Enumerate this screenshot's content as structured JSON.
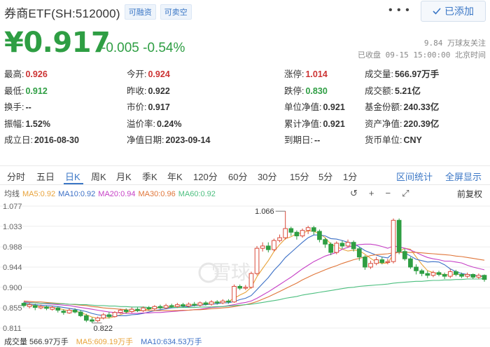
{
  "header": {
    "stock_name": "券商ETF(SH:512000)",
    "tags": [
      "可融资",
      "可卖空"
    ],
    "more": "• • •",
    "add_button": "已添加",
    "check_icon": "check-icon"
  },
  "quote": {
    "price": "¥0.917",
    "change": "-0.005 -0.54%",
    "followers": "9.84 万球友关注",
    "status": "已收盘 09-15 15:00:00 北京时间"
  },
  "stats": [
    {
      "label": "最高:",
      "value": "0.926",
      "tone": "red"
    },
    {
      "label": "今开:",
      "value": "0.924",
      "tone": "red"
    },
    {
      "label": "涨停:",
      "value": "1.014",
      "tone": "red"
    },
    {
      "label": "成交量:",
      "value": "566.97万手",
      "tone": ""
    },
    {
      "label": "最低:",
      "value": "0.912",
      "tone": "green"
    },
    {
      "label": "昨收:",
      "value": "0.922",
      "tone": ""
    },
    {
      "label": "跌停:",
      "value": "0.830",
      "tone": "green"
    },
    {
      "label": "成交额:",
      "value": "5.21亿",
      "tone": ""
    },
    {
      "label": "换手:",
      "value": "--",
      "tone": ""
    },
    {
      "label": "市价:",
      "value": "0.917",
      "tone": ""
    },
    {
      "label": "单位净值:",
      "value": "0.921",
      "tone": ""
    },
    {
      "label": "基金份额:",
      "value": "240.33亿",
      "tone": ""
    },
    {
      "label": "振幅:",
      "value": "1.52%",
      "tone": ""
    },
    {
      "label": "溢价率:",
      "value": "0.24%",
      "tone": ""
    },
    {
      "label": "累计净值:",
      "value": "0.921",
      "tone": ""
    },
    {
      "label": "资产净值:",
      "value": "220.39亿",
      "tone": ""
    },
    {
      "label": "成立日:",
      "value": "2016-08-30",
      "tone": ""
    },
    {
      "label": "净值日期:",
      "value": "2023-09-14",
      "tone": ""
    },
    {
      "label": "到期日:",
      "value": "--",
      "tone": ""
    },
    {
      "label": "货币单位:",
      "value": "CNY",
      "tone": ""
    }
  ],
  "tabs": [
    "分时",
    "五日",
    "日K",
    "周K",
    "月K",
    "季K",
    "年K",
    "120分",
    "60分",
    "30分",
    "15分",
    "5分",
    "1分"
  ],
  "active_tab": "日K",
  "tab_actions": [
    "区间统计",
    "全屏显示"
  ],
  "ma_legend": [
    {
      "label": "均线",
      "color": "#555555"
    },
    {
      "label": "MA5:0.92",
      "color": "#e8a33a"
    },
    {
      "label": "MA10:0.92",
      "color": "#3b6fc6"
    },
    {
      "label": "MA20:0.94",
      "color": "#c640c6"
    },
    {
      "label": "MA30:0.96",
      "color": "#e0763a"
    },
    {
      "label": "MA60:0.92",
      "color": "#4cbf7f"
    }
  ],
  "chart_tools": [
    "↺",
    "+",
    "−",
    "⤢"
  ],
  "fuquan": "前复权",
  "watermark": "雪球",
  "chart_data": {
    "type": "candlestick",
    "y_ticks": [
      "1.077",
      "1.033",
      "0.988",
      "0.944",
      "0.900",
      "0.855",
      "0.811"
    ],
    "ylim": [
      0.811,
      1.077
    ],
    "high_label": "1.066",
    "low_label": "0.822",
    "candles": [
      [
        0.865,
        0.86,
        0.868,
        0.856
      ],
      [
        0.858,
        0.862,
        0.866,
        0.854
      ],
      [
        0.86,
        0.856,
        0.864,
        0.85
      ],
      [
        0.855,
        0.858,
        0.862,
        0.852
      ],
      [
        0.857,
        0.854,
        0.86,
        0.85
      ],
      [
        0.852,
        0.856,
        0.86,
        0.849
      ],
      [
        0.855,
        0.85,
        0.858,
        0.845
      ],
      [
        0.848,
        0.845,
        0.852,
        0.84
      ],
      [
        0.844,
        0.85,
        0.854,
        0.842
      ],
      [
        0.85,
        0.846,
        0.854,
        0.843
      ],
      [
        0.846,
        0.838,
        0.85,
        0.835
      ],
      [
        0.838,
        0.828,
        0.842,
        0.824
      ],
      [
        0.829,
        0.826,
        0.834,
        0.822
      ],
      [
        0.827,
        0.833,
        0.836,
        0.824
      ],
      [
        0.833,
        0.84,
        0.844,
        0.83
      ],
      [
        0.84,
        0.836,
        0.846,
        0.832
      ],
      [
        0.836,
        0.845,
        0.848,
        0.834
      ],
      [
        0.845,
        0.85,
        0.853,
        0.842
      ],
      [
        0.85,
        0.847,
        0.854,
        0.843
      ],
      [
        0.847,
        0.852,
        0.856,
        0.844
      ],
      [
        0.852,
        0.849,
        0.856,
        0.846
      ],
      [
        0.849,
        0.855,
        0.858,
        0.846
      ],
      [
        0.855,
        0.853,
        0.859,
        0.85
      ],
      [
        0.853,
        0.858,
        0.861,
        0.85
      ],
      [
        0.858,
        0.855,
        0.862,
        0.852
      ],
      [
        0.855,
        0.86,
        0.864,
        0.852
      ],
      [
        0.86,
        0.858,
        0.864,
        0.855
      ],
      [
        0.858,
        0.862,
        0.866,
        0.855
      ],
      [
        0.862,
        0.859,
        0.866,
        0.856
      ],
      [
        0.859,
        0.863,
        0.867,
        0.856
      ],
      [
        0.863,
        0.861,
        0.868,
        0.858
      ],
      [
        0.861,
        0.866,
        0.869,
        0.858
      ],
      [
        0.866,
        0.863,
        0.87,
        0.86
      ],
      [
        0.863,
        0.868,
        0.872,
        0.86
      ],
      [
        0.868,
        0.866,
        0.872,
        0.862
      ],
      [
        0.866,
        0.87,
        0.874,
        0.863
      ],
      [
        0.87,
        0.868,
        0.874,
        0.864
      ],
      [
        0.868,
        0.902,
        0.906,
        0.866
      ],
      [
        0.902,
        0.898,
        0.906,
        0.894
      ],
      [
        0.898,
        0.9,
        0.905,
        0.894
      ],
      [
        0.9,
        0.93,
        0.934,
        0.897
      ],
      [
        0.93,
        0.985,
        0.99,
        0.926
      ],
      [
        0.985,
        0.99,
        0.998,
        0.978
      ],
      [
        0.99,
        0.982,
        0.998,
        0.976
      ],
      [
        0.982,
        1.002,
        1.006,
        0.978
      ],
      [
        1.002,
        1.008,
        1.015,
        0.998
      ],
      [
        1.008,
        1.028,
        1.066,
        1.004
      ],
      [
        1.028,
        1.02,
        1.032,
        1.012
      ],
      [
        1.02,
        1.012,
        1.024,
        1.004
      ],
      [
        1.012,
        1.024,
        1.028,
        1.008
      ],
      [
        1.024,
        1.03,
        1.034,
        1.016
      ],
      [
        1.03,
        1.022,
        1.034,
        1.014
      ],
      [
        1.022,
        1.004,
        1.026,
        0.998
      ],
      [
        1.004,
        0.994,
        1.008,
        0.986
      ],
      [
        0.994,
        0.976,
        0.998,
        0.97
      ],
      [
        0.976,
        0.996,
        1.0,
        0.972
      ],
      [
        0.996,
        0.99,
        1.002,
        0.984
      ],
      [
        0.99,
        0.998,
        1.004,
        0.986
      ],
      [
        0.998,
        0.984,
        1.002,
        0.978
      ],
      [
        0.984,
        0.966,
        0.988,
        0.958
      ],
      [
        0.966,
        0.944,
        0.97,
        0.938
      ],
      [
        0.944,
        0.952,
        0.958,
        0.94
      ],
      [
        0.952,
        0.96,
        0.966,
        0.948
      ],
      [
        0.96,
        0.954,
        0.966,
        0.95
      ],
      [
        0.954,
        0.956,
        0.962,
        0.95
      ],
      [
        0.956,
        1.046,
        1.05,
        0.952
      ],
      [
        1.046,
        0.978,
        1.05,
        0.972
      ],
      [
        0.978,
        0.962,
        0.984,
        0.958
      ],
      [
        0.962,
        0.944,
        0.966,
        0.94
      ],
      [
        0.944,
        0.936,
        0.95,
        0.928
      ],
      [
        0.936,
        0.93,
        0.94,
        0.924
      ],
      [
        0.93,
        0.926,
        0.936,
        0.92
      ],
      [
        0.926,
        0.932,
        0.936,
        0.922
      ],
      [
        0.932,
        0.928,
        0.936,
        0.924
      ],
      [
        0.928,
        0.924,
        0.932,
        0.918
      ],
      [
        0.924,
        0.934,
        0.94,
        0.92
      ],
      [
        0.934,
        0.928,
        0.938,
        0.924
      ],
      [
        0.928,
        0.924,
        0.932,
        0.92
      ],
      [
        0.924,
        0.928,
        0.932,
        0.92
      ],
      [
        0.928,
        0.922,
        0.93,
        0.918
      ],
      [
        0.922,
        0.926,
        0.93,
        0.918
      ],
      [
        0.926,
        0.917,
        0.928,
        0.912
      ]
    ],
    "ma_lines": [
      {
        "name": "MA5",
        "color": "#e8a33a",
        "values": [
          0.862,
          0.861,
          0.86,
          0.858,
          0.857,
          0.856,
          0.854,
          0.851,
          0.849,
          0.848,
          0.845,
          0.84,
          0.835,
          0.832,
          0.833,
          0.833,
          0.836,
          0.84,
          0.845,
          0.848,
          0.849,
          0.851,
          0.852,
          0.854,
          0.856,
          0.857,
          0.858,
          0.859,
          0.86,
          0.861,
          0.862,
          0.863,
          0.864,
          0.866,
          0.867,
          0.868,
          0.869,
          0.876,
          0.883,
          0.889,
          0.9,
          0.923,
          0.941,
          0.958,
          0.978,
          0.993,
          1.006,
          1.01,
          1.017,
          1.018,
          1.023,
          1.022,
          1.017,
          1.008,
          0.994,
          0.988,
          0.983,
          0.979,
          0.981,
          0.98,
          0.972,
          0.963,
          0.955,
          0.952,
          0.953,
          0.972,
          0.978,
          0.985,
          0.983,
          0.966,
          0.95,
          0.936,
          0.932,
          0.929,
          0.928,
          0.927,
          0.928,
          0.928,
          0.927,
          0.926,
          0.924,
          0.923
        ]
      },
      {
        "name": "MA10",
        "color": "#3b6fc6",
        "values": [
          0.864,
          0.863,
          0.862,
          0.861,
          0.86,
          0.859,
          0.858,
          0.856,
          0.854,
          0.852,
          0.85,
          0.847,
          0.843,
          0.84,
          0.838,
          0.837,
          0.838,
          0.838,
          0.838,
          0.84,
          0.841,
          0.843,
          0.846,
          0.849,
          0.851,
          0.853,
          0.855,
          0.856,
          0.857,
          0.858,
          0.86,
          0.861,
          0.862,
          0.863,
          0.864,
          0.866,
          0.866,
          0.869,
          0.873,
          0.876,
          0.882,
          0.895,
          0.908,
          0.921,
          0.937,
          0.95,
          0.965,
          0.976,
          0.987,
          0.998,
          1.008,
          1.014,
          1.014,
          1.012,
          1.006,
          1.005,
          1.002,
          0.998,
          0.995,
          0.988,
          0.98,
          0.975,
          0.97,
          0.966,
          0.964,
          0.975,
          0.978,
          0.975,
          0.968,
          0.961,
          0.958,
          0.955,
          0.956,
          0.955,
          0.949,
          0.94,
          0.934,
          0.93,
          0.928,
          0.926,
          0.925,
          0.924
        ]
      },
      {
        "name": "MA20",
        "color": "#c640c6",
        "values": [
          0.868,
          0.867,
          0.866,
          0.865,
          0.864,
          0.863,
          0.862,
          0.861,
          0.86,
          0.858,
          0.856,
          0.854,
          0.852,
          0.85,
          0.848,
          0.846,
          0.845,
          0.844,
          0.843,
          0.843,
          0.843,
          0.844,
          0.844,
          0.845,
          0.845,
          0.846,
          0.847,
          0.848,
          0.849,
          0.85,
          0.851,
          0.852,
          0.854,
          0.856,
          0.857,
          0.858,
          0.86,
          0.862,
          0.865,
          0.867,
          0.87,
          0.876,
          0.883,
          0.89,
          0.898,
          0.906,
          0.914,
          0.922,
          0.931,
          0.94,
          0.948,
          0.956,
          0.962,
          0.968,
          0.972,
          0.976,
          0.983,
          0.987,
          0.991,
          0.993,
          0.994,
          0.994,
          0.992,
          0.989,
          0.985,
          0.99,
          0.988,
          0.985,
          0.981,
          0.976,
          0.97,
          0.965,
          0.962,
          0.96,
          0.957,
          0.957,
          0.955,
          0.953,
          0.948,
          0.944,
          0.941,
          0.938
        ]
      },
      {
        "name": "MA30",
        "color": "#e0763a",
        "values": [
          0.87,
          0.869,
          0.868,
          0.868,
          0.867,
          0.866,
          0.865,
          0.864,
          0.863,
          0.862,
          0.861,
          0.86,
          0.858,
          0.857,
          0.855,
          0.854,
          0.853,
          0.852,
          0.851,
          0.85,
          0.849,
          0.849,
          0.849,
          0.849,
          0.849,
          0.849,
          0.849,
          0.849,
          0.85,
          0.85,
          0.851,
          0.851,
          0.852,
          0.853,
          0.854,
          0.855,
          0.856,
          0.858,
          0.86,
          0.862,
          0.865,
          0.869,
          0.874,
          0.879,
          0.885,
          0.891,
          0.897,
          0.903,
          0.909,
          0.916,
          0.922,
          0.928,
          0.933,
          0.938,
          0.943,
          0.947,
          0.952,
          0.956,
          0.96,
          0.963,
          0.966,
          0.969,
          0.971,
          0.972,
          0.973,
          0.975,
          0.976,
          0.976,
          0.976,
          0.976,
          0.975,
          0.974,
          0.973,
          0.972,
          0.971,
          0.97,
          0.968,
          0.967,
          0.965,
          0.963,
          0.961,
          0.959
        ]
      },
      {
        "name": "MA60",
        "color": "#4cbf7f",
        "values": [
          0.866,
          0.866,
          0.866,
          0.865,
          0.865,
          0.865,
          0.864,
          0.864,
          0.863,
          0.863,
          0.862,
          0.862,
          0.861,
          0.86,
          0.86,
          0.859,
          0.859,
          0.858,
          0.858,
          0.857,
          0.857,
          0.857,
          0.856,
          0.856,
          0.856,
          0.856,
          0.856,
          0.856,
          0.856,
          0.856,
          0.856,
          0.857,
          0.857,
          0.857,
          0.858,
          0.858,
          0.859,
          0.86,
          0.861,
          0.862,
          0.863,
          0.865,
          0.867,
          0.869,
          0.871,
          0.873,
          0.876,
          0.878,
          0.88,
          0.883,
          0.885,
          0.887,
          0.889,
          0.891,
          0.893,
          0.895,
          0.897,
          0.899,
          0.9,
          0.902,
          0.903,
          0.904,
          0.905,
          0.906,
          0.907,
          0.909,
          0.91,
          0.911,
          0.912,
          0.913,
          0.913,
          0.914,
          0.915,
          0.915,
          0.916,
          0.916,
          0.917,
          0.917,
          0.918,
          0.918,
          0.918,
          0.919
        ]
      }
    ],
    "volume": "成交量 566.97万手",
    "vol_ma5": "MA5:609.19万手",
    "vol_ma10": "MA10:634.53万手",
    "up_color": "#d94a3a",
    "down_color": "#2e9e43"
  }
}
